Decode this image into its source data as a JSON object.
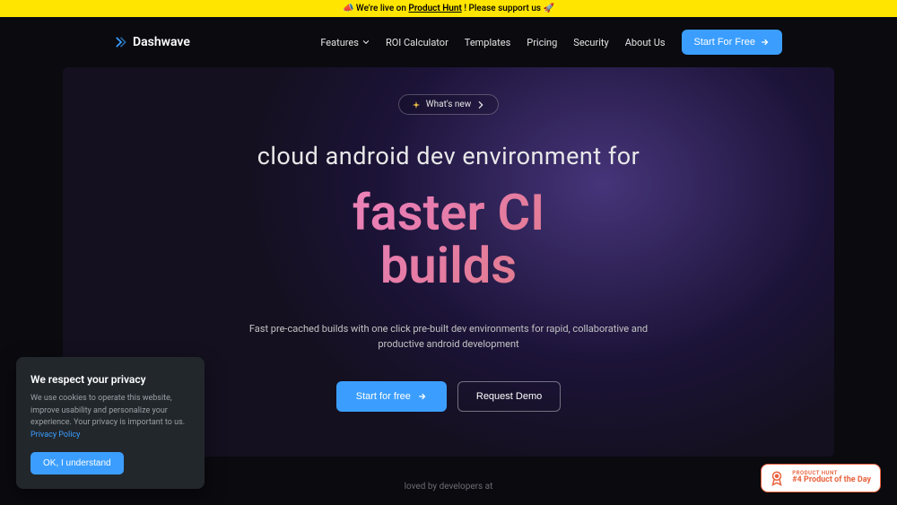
{
  "banner": {
    "pre": "📣 We're live on ",
    "link": "Product Hunt",
    "post": " ! Please support us 🚀"
  },
  "logo": {
    "text": "Dashwave"
  },
  "nav": {
    "features": "Features",
    "roi": "ROI Calculator",
    "templates": "Templates",
    "pricing": "Pricing",
    "security": "Security",
    "about": "About Us",
    "cta": "Start For Free"
  },
  "hero": {
    "pill": "What's new",
    "headline": "cloud android dev environment for",
    "big1": "faster CI",
    "big2": "builds",
    "subtext": "Fast pre-cached builds with one click pre-built dev environments for rapid, collaborative and productive android development",
    "cta_primary": "Start for free",
    "cta_secondary": "Request Demo"
  },
  "loved_by": "loved by developers at",
  "cookies": {
    "title": "We respect your privacy",
    "body_pre": "We use cookies to operate this website, improve usability and personalize your experience. Your privacy is important to us. ",
    "policy": "Privacy Policy",
    "btn": "OK, I understand"
  },
  "ph": {
    "label": "PRODUCT HUNT",
    "rank": "#4 Product of the Day"
  }
}
